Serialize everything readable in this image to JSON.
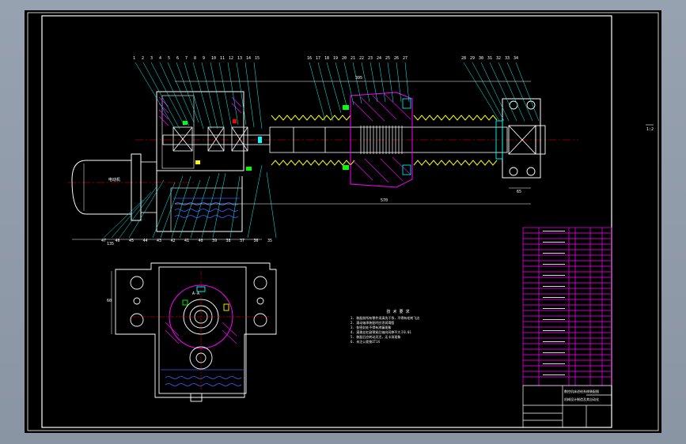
{
  "window": {
    "background": "#8f9aa8"
  },
  "canvas": {
    "background": "#000000"
  },
  "colors": {
    "frame": "#ffffff",
    "outline": "#ffffff",
    "leader": "#00ffff",
    "hatch": "#ff00ff",
    "centerline": "#ff0000",
    "spring": "#ffff00",
    "fluid": "#3b5bff",
    "table": "#ff00ff",
    "bolt": "#00ff00"
  },
  "balloons": {
    "top_left": [
      "1",
      "2",
      "3",
      "4",
      "5",
      "6",
      "7",
      "8",
      "9",
      "10",
      "11",
      "12",
      "13",
      "14",
      "15"
    ],
    "top_mid": [
      "16",
      "17",
      "18",
      "19",
      "20",
      "21",
      "22",
      "23",
      "24",
      "25",
      "26",
      "27"
    ],
    "top_right": [
      "28",
      "29",
      "30",
      "31",
      "32",
      "33",
      "34"
    ],
    "bottom": [
      "47",
      "46",
      "45",
      "44",
      "43",
      "42",
      "41",
      "40",
      "39",
      "38",
      "37",
      "36",
      "35"
    ]
  },
  "dimensions": {
    "upper": "395",
    "lower": "570",
    "side_left": "60",
    "side_right": "65",
    "bottom_left": "135"
  },
  "notes_title": "技 术 要 求",
  "notes_lines": [
    "1. 装配前所有零件须清洗干净，不得有毛刺飞边",
    "2. 滚动轴承装配时应涂润滑脂",
    "3. 各密封处不得有渗漏现象",
    "4. 滚珠丝杠副预紧后轴向间隙不大于0.01",
    "5. 装配后应转动灵活，无卡滞现象",
    "6. 未注公差按IT14"
  ],
  "right_mark": "1:2",
  "motor_label": "电动机",
  "section_label": "A-A",
  "title_block": {
    "drawing_name": "数控机床进给系统装配图",
    "school": "机械设计制造及其自动化"
  }
}
